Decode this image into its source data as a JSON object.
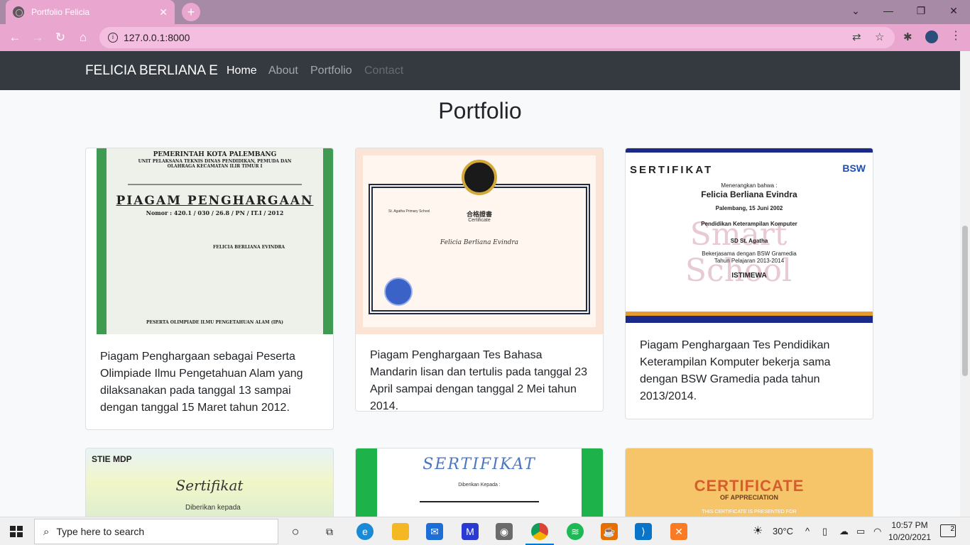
{
  "browser": {
    "tab_title": "Portfolio Felicia",
    "tab_close": "✕",
    "new_tab": "+",
    "url": "127.0.0.1:8000",
    "window_controls": {
      "dropdown": "⌄",
      "minimize": "—",
      "maximize": "❐",
      "close": "✕"
    }
  },
  "navbar": {
    "brand": "FELICIA BERLIANA E",
    "links": [
      {
        "label": "Home",
        "state": "active"
      },
      {
        "label": "About",
        "state": "normal"
      },
      {
        "label": "Portfolio",
        "state": "normal"
      },
      {
        "label": "Contact",
        "state": "disabled"
      }
    ]
  },
  "page": {
    "title": "Portfolio",
    "cards": [
      {
        "description": "Piagam Penghargaan sebagai Peserta Olimpiade Ilmu Pengetahuan Alam yang dilaksanakan pada tanggal 13 sampai dengan tanggal 15 Maret tahun 2012.",
        "image": {
          "header": "PEMERINTAH KOTA PALEMBANG",
          "sub": "UNIT PELAKSANA TEKNIS DINAS PENDIDIKAN, PEMUDA DAN OLAHRAGA KECAMATAN ILIR TIMUR I",
          "title": "PIAGAM PENGHARGAAN",
          "number": "Nomor : 420.1 / 030 / 26.8 / PN / IT.I / 2012",
          "name": "FELICIA BERLIANA EVINDRA",
          "footer": "PESERTA OLIMPIADE ILMU PENGETAHUAN ALAM (IPA)"
        }
      },
      {
        "description": "Piagam Penghargaan Tes Bahasa Mandarin lisan dan tertulis pada tanggal 23 April sampai dengan tanggal 2 Mei tahun 2014.",
        "image": {
          "title": "合格證書",
          "subtitle": "Certificate",
          "name": "Felicia Berliana Evindra",
          "school": "St. Agatha Primary School"
        }
      },
      {
        "description": "Piagam Penghargaan Tes Pendidikan Keterampilan Komputer bekerja sama dengan BSW Gramedia pada tahun 2013/2014.",
        "image": {
          "header": "SERTIFIKAT",
          "brand": "BSW",
          "intro": "Menerangkan bahwa :",
          "name": "Felicia Berliana Evindra",
          "dob": "Palembang, 15 Juni 2002",
          "course": "Pendidikan Keterampilan Komputer",
          "school": "SD St. Agatha",
          "partner": "Bekerjasama dengan BSW Gramedia",
          "year": "Tahun Pelajaran 2013-2014",
          "result": "ISTIMEWA",
          "watermark": "Smart School"
        }
      },
      {
        "image": {
          "header": "STIE MDP",
          "title": "Sertifikat",
          "sub": "Diberikan kepada"
        }
      },
      {
        "image": {
          "title": "SERTIFIKAT",
          "sub": "Diberikan Kepada :"
        }
      },
      {
        "image": {
          "title": "CERTIFICATE",
          "sub": "OF APPRECIATION",
          "note": "THIS CERTIFICATE IS PRESENTED FOR"
        }
      }
    ]
  },
  "taskbar": {
    "search_placeholder": "Type here to search",
    "weather": "30°C",
    "time": "10:57 PM",
    "date": "10/20/2021",
    "notifications": "2"
  }
}
